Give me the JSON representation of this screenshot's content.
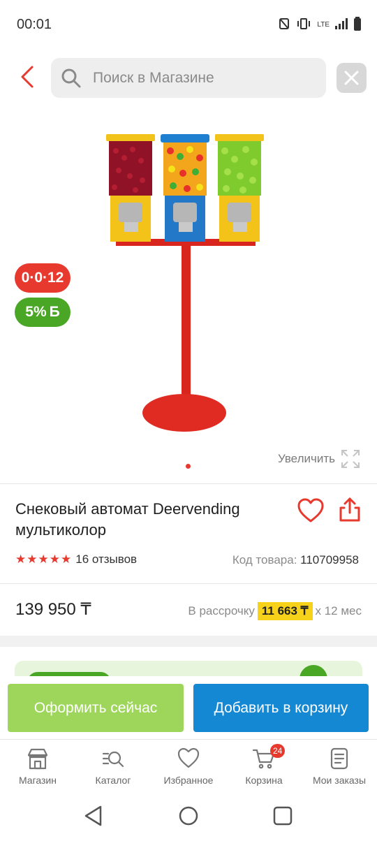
{
  "status_bar": {
    "time": "00:01",
    "network": "LTE"
  },
  "search": {
    "placeholder": "Поиск в Магазине"
  },
  "badges": {
    "installment": "0·0·12",
    "bonus": "5%",
    "bonus_currency": "Б"
  },
  "gallery": {
    "zoom_label": "Увеличить"
  },
  "product": {
    "title": "Снековый автомат Deervending мультиколор",
    "rating_stars": 5,
    "reviews": "16 отзывов",
    "sku_label": "Код товара:",
    "sku_value": "110709958",
    "price": "139 950 ₸",
    "installment_label": "В рассрочку",
    "installment_amount": "11 663 ₸",
    "installment_term": "х 12 мес"
  },
  "actions": {
    "buy_now": "Оформить сейчас",
    "add_to_cart": "Добавить в корзину"
  },
  "tabs": [
    {
      "label": "Магазин",
      "icon": "store-icon"
    },
    {
      "label": "Каталог",
      "icon": "catalog-search-icon"
    },
    {
      "label": "Избранное",
      "icon": "heart-icon"
    },
    {
      "label": "Корзина",
      "icon": "cart-icon",
      "badge": "24"
    },
    {
      "label": "Мои заказы",
      "icon": "orders-icon"
    }
  ],
  "colors": {
    "accent_red": "#e7392d",
    "bonus_green": "#4aa625",
    "buy_green": "#9dd65a",
    "cart_blue": "#1588d4",
    "installment_yellow": "#f7d21b"
  }
}
